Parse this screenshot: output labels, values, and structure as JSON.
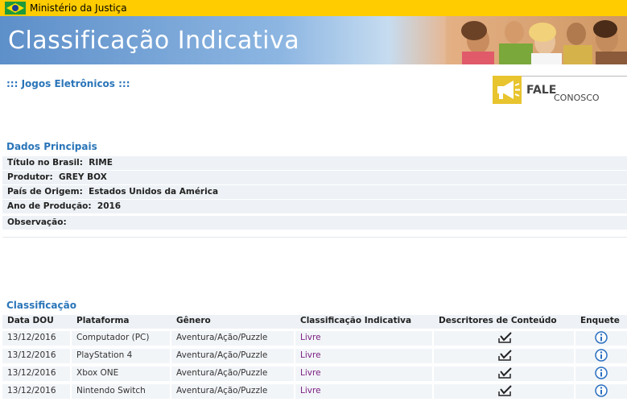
{
  "topbar": {
    "ministry": "Ministério da Justiça"
  },
  "banner": {
    "title": "Classificação Indicativa"
  },
  "section_link": "::: Jogos Eletrônicos :::",
  "fale": {
    "main": "FALE",
    "sub": "CONOSCO"
  },
  "dados": {
    "title": "Dados Principais",
    "rows": [
      {
        "label": "Título no Brasil:",
        "value": "RIME"
      },
      {
        "label": "Produtor:",
        "value": "GREY BOX"
      },
      {
        "label": "País de Origem:",
        "value": "Estados Unidos da América"
      },
      {
        "label": "Ano de Produção:",
        "value": "2016"
      },
      {
        "label": "Observação:",
        "value": ""
      }
    ]
  },
  "classificacao": {
    "title": "Classificação",
    "headers": [
      "Data DOU",
      "Plataforma",
      "Gênero",
      "Classificação Indicativa",
      "Descritores de Conteúdo",
      "Enquete"
    ],
    "rows": [
      {
        "data": "13/12/2016",
        "plataforma": "Computador (PC)",
        "genero": "Aventura/Ação/Puzzle",
        "classificacao": "Livre"
      },
      {
        "data": "13/12/2016",
        "plataforma": "PlayStation 4",
        "genero": "Aventura/Ação/Puzzle",
        "classificacao": "Livre"
      },
      {
        "data": "13/12/2016",
        "plataforma": "Xbox ONE",
        "genero": "Aventura/Ação/Puzzle",
        "classificacao": "Livre"
      },
      {
        "data": "13/12/2016",
        "plataforma": "Nintendo Switch",
        "genero": "Aventura/Ação/Puzzle",
        "classificacao": "Livre"
      }
    ]
  },
  "colors": {
    "topbar": "#ffcc00",
    "link_blue": "#2a75b9",
    "livre": "#7b1f80",
    "row_bg": "#eef2f6"
  },
  "icons": {
    "descritor": "checklist-icon",
    "enquete": "info-icon"
  }
}
